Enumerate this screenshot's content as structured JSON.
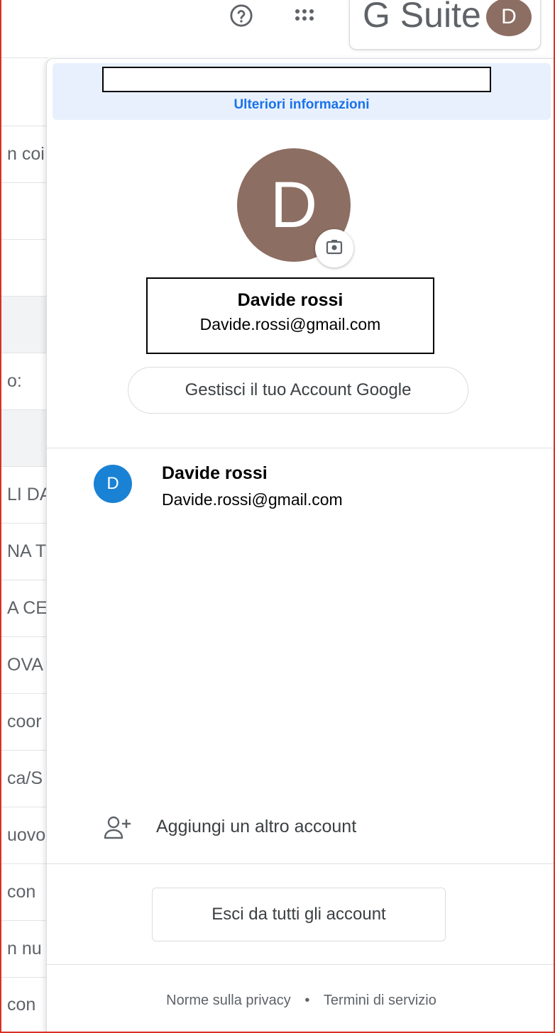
{
  "background_rows": [
    {
      "text": "n coi",
      "shaded": false
    },
    {
      "text": "",
      "shaded": false
    },
    {
      "text": "",
      "shaded": false
    },
    {
      "text": "",
      "shaded": true
    },
    {
      "text": "o:",
      "shaded": false
    },
    {
      "text": "",
      "shaded": true
    },
    {
      "text": "LI DA",
      "shaded": false
    },
    {
      "text": "NA TO",
      "shaded": false
    },
    {
      "text": "A CE",
      "shaded": false
    },
    {
      "text": "OVA",
      "shaded": false
    },
    {
      "text": "coor",
      "shaded": false
    },
    {
      "text": "ca/S",
      "shaded": false
    },
    {
      "text": "uovo",
      "shaded": false
    },
    {
      "text": "con",
      "shaded": false
    },
    {
      "text": "n nu",
      "shaded": false
    },
    {
      "text": "con",
      "shaded": false
    }
  ],
  "topbar": {
    "help_icon": "help-circle-icon",
    "apps_icon": "apps-grid-icon",
    "brand_text": "G Suite",
    "avatar_letter": "D"
  },
  "popup": {
    "banner_link": "Ulteriori informazioni",
    "avatar_letter": "D",
    "camera_icon": "camera-icon",
    "name": "Davide rossi",
    "email": "Davide.rossi@gmail.com",
    "manage_button": "Gestisci il tuo Account Google",
    "accounts": [
      {
        "letter": "D",
        "name": "Davide rossi",
        "email": "Davide.rossi@gmail.com"
      }
    ],
    "add_account_icon": "person-add-icon",
    "add_account_label": "Aggiungi un altro account",
    "signout_button": "Esci da tutti gli account",
    "footer": {
      "privacy": "Norme sulla privacy",
      "separator": "•",
      "terms": "Termini di servizio"
    }
  }
}
